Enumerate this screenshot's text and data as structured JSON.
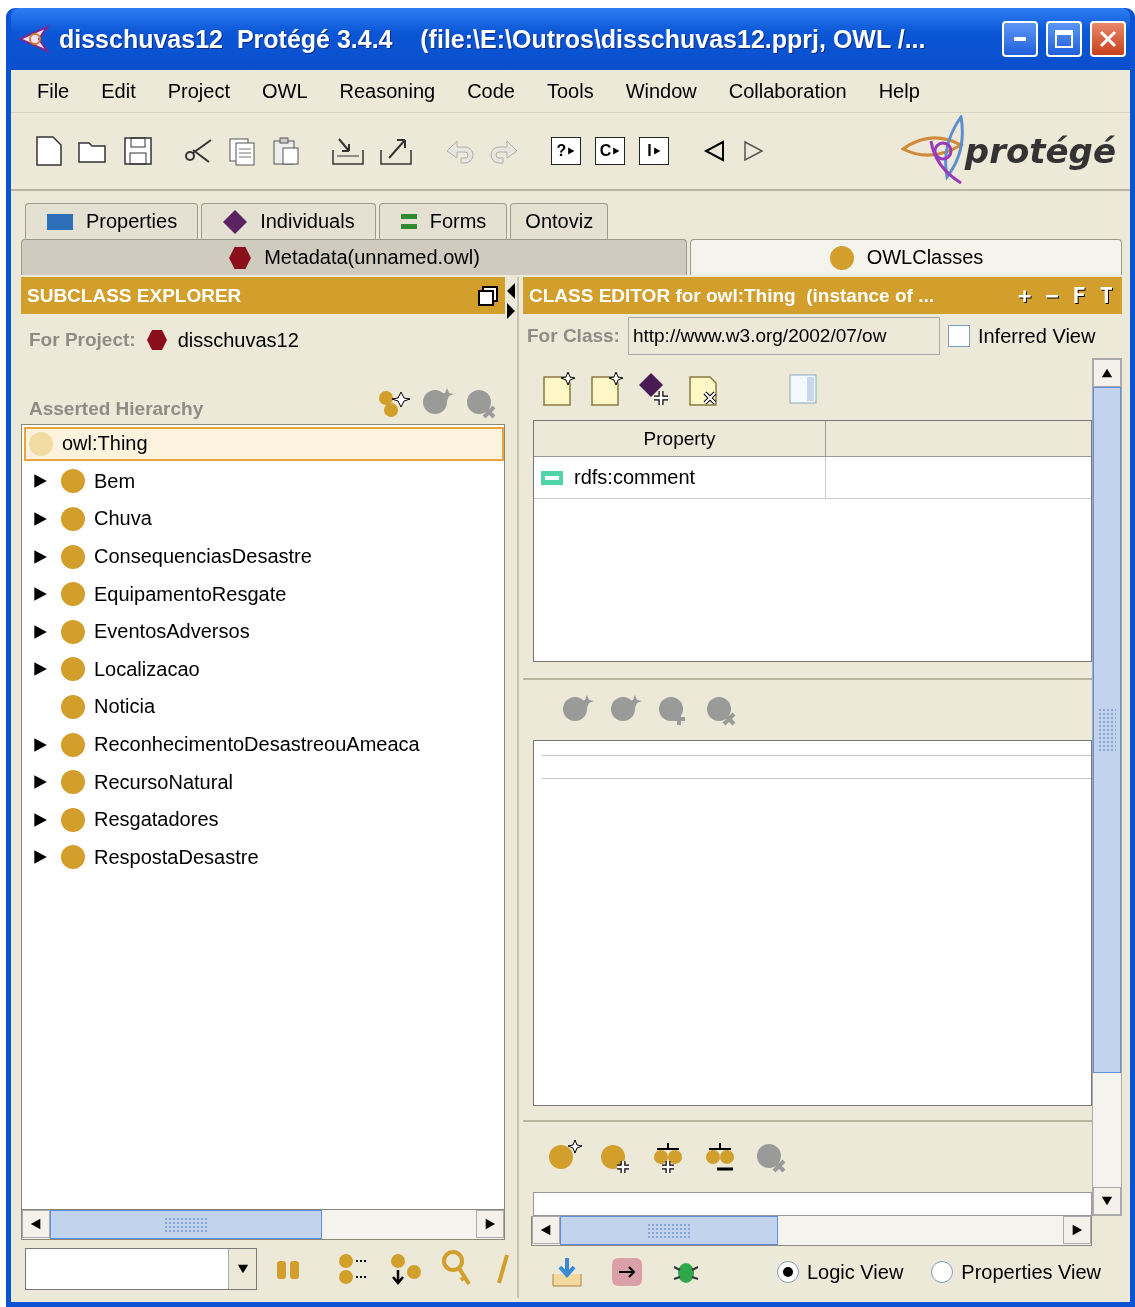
{
  "window": {
    "title": "disschuvas12  Protégé 3.4.4    (file:\\E:\\Outros\\disschuvas12.pprj, OWL /..."
  },
  "menu": [
    "File",
    "Edit",
    "Project",
    "OWL",
    "Reasoning",
    "Code",
    "Tools",
    "Window",
    "Collaboration",
    "Help"
  ],
  "toolbar": {
    "query_buttons": [
      "?",
      "C",
      "I"
    ],
    "logo": "protégé"
  },
  "tabs_back": [
    {
      "label": "Properties",
      "kind": "property",
      "selected": false
    },
    {
      "label": "Individuals",
      "kind": "individual",
      "selected": false
    },
    {
      "label": "Forms",
      "kind": "form",
      "selected": false
    },
    {
      "label": "Ontoviz",
      "kind": "plain",
      "selected": false
    }
  ],
  "tabs_front": [
    {
      "label": "Metadata(unnamed.owl)",
      "kind": "metadata",
      "selected": false
    },
    {
      "label": "OWLClasses",
      "kind": "class",
      "selected": true
    }
  ],
  "subclass_explorer": {
    "title": "SUBCLASS EXPLORER",
    "project_label": "For Project:",
    "project_name": "disschuvas12",
    "hierarchy_label": "Asserted Hierarchy",
    "tree": [
      {
        "label": "owl:Thing",
        "kind": "root",
        "selected": true,
        "children": [
          {
            "label": "Bem",
            "kind": "branch",
            "selected": false
          },
          {
            "label": "Chuva",
            "kind": "branch",
            "selected": false
          },
          {
            "label": "ConsequenciasDesastre",
            "kind": "branch",
            "selected": false
          },
          {
            "label": "EquipamentoResgate",
            "kind": "branch",
            "selected": false
          },
          {
            "label": "EventosAdversos",
            "kind": "branch",
            "selected": false
          },
          {
            "label": "Localizacao",
            "kind": "branch",
            "selected": false
          },
          {
            "label": "Noticia",
            "kind": "leaf",
            "selected": false
          },
          {
            "label": "ReconhecimentoDesastreouAmeaca",
            "kind": "branch",
            "selected": false
          },
          {
            "label": "RecursoNatural",
            "kind": "branch",
            "selected": false
          },
          {
            "label": "Resgatadores",
            "kind": "branch",
            "selected": false
          },
          {
            "label": "RespostaDesastre",
            "kind": "branch",
            "selected": false
          }
        ]
      }
    ]
  },
  "class_editor": {
    "title": "CLASS EDITOR for owl:Thing  (instance of ...",
    "header_buttons": [
      "+",
      "−",
      "F",
      "T"
    ],
    "class_label": "For Class:",
    "class_uri": "http://www.w3.org/2002/07/ow",
    "inferred_view": {
      "label": "Inferred View",
      "checked": false
    },
    "table": {
      "columns": [
        "Property"
      ],
      "rows": [
        {
          "property": "rdfs:comment"
        }
      ]
    },
    "views": [
      {
        "label": "Logic View",
        "selected": true
      },
      {
        "label": "Properties View",
        "selected": false
      }
    ]
  }
}
